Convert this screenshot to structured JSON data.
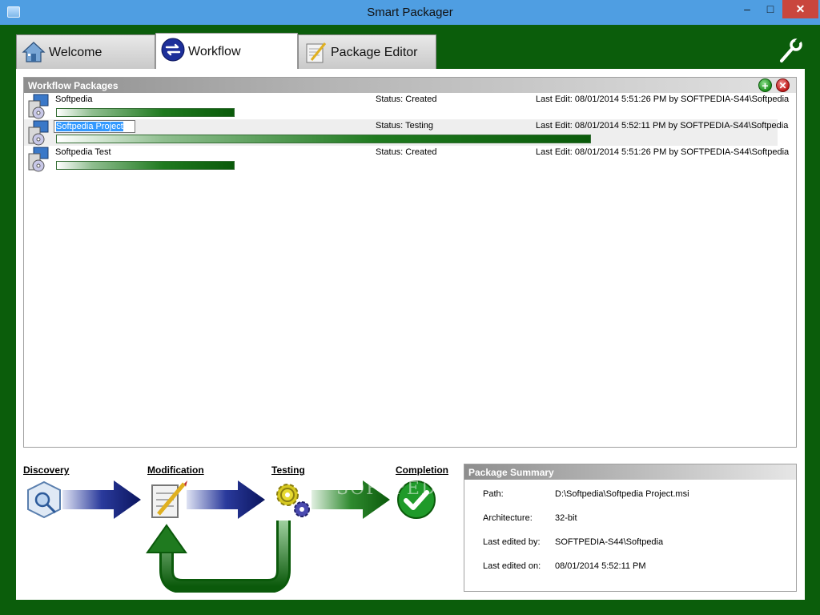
{
  "window": {
    "title": "Smart Packager",
    "controls": {
      "minimize": "–",
      "maximize": "□",
      "close": "✕"
    }
  },
  "tabs": [
    {
      "label": "Welcome",
      "icon": "house-icon"
    },
    {
      "label": "Workflow",
      "icon": "swap-arrows-icon",
      "active": true
    },
    {
      "label": "Package Editor",
      "icon": "notepad-pencil-icon"
    }
  ],
  "workflow_packages": {
    "title": "Workflow Packages",
    "rows": [
      {
        "name": "Softpedia",
        "status": "Status: Created",
        "last_edit": "Last Edit: 08/01/2014 5:51:26 PM by SOFTPEDIA-S44\\Softpedia",
        "progress": 0.25
      },
      {
        "name": "Softpedia Project",
        "status": "Status: Testing",
        "last_edit": "Last Edit: 08/01/2014 5:52:11 PM by SOFTPEDIA-S44\\Softpedia",
        "progress": 0.75
      },
      {
        "name": "Softpedia Test",
        "status": "Status: Created",
        "last_edit": "Last Edit: 08/01/2014 5:51:26 PM by SOFTPEDIA-S44\\Softpedia",
        "progress": 0.25
      }
    ]
  },
  "stages": [
    {
      "label": "Discovery",
      "icon": "magnifier-box-icon"
    },
    {
      "label": "Modification",
      "icon": "notepad-pencil-icon"
    },
    {
      "label": "Testing",
      "icon": "gears-icon"
    },
    {
      "label": "Completion",
      "icon": "checkmark-icon"
    }
  ],
  "summary": {
    "title": "Package Summary",
    "fields": [
      {
        "label": "Path:",
        "value": "D:\\Softpedia\\Softpedia Project.msi"
      },
      {
        "label": "Architecture:",
        "value": "32-bit"
      },
      {
        "label": "Last edited by:",
        "value": "SOFTPEDIA-S44\\Softpedia"
      },
      {
        "label": "Last edited on:",
        "value": "08/01/2014 5:52:11 PM"
      }
    ]
  },
  "watermark": "SOFTPEDIA",
  "colors": {
    "frame": "#0b5d0b",
    "titlebar": "#4f9ee2",
    "progress": "#1f7a1f",
    "close": "#c9463d"
  }
}
